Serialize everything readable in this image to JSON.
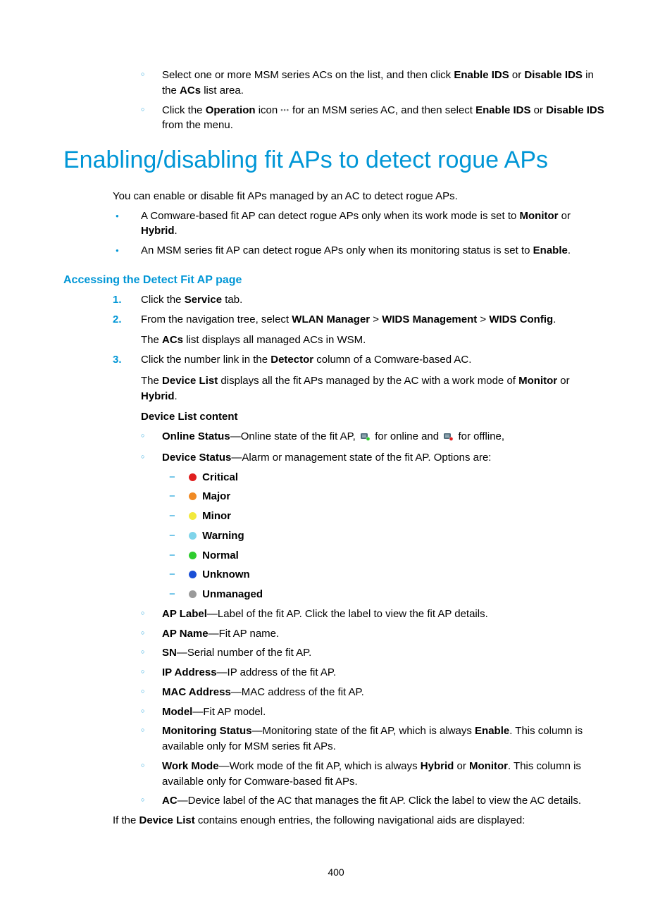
{
  "intro_bullets": [
    {
      "parts": [
        {
          "t": "Select one or more MSM series ACs on the list, and then click "
        },
        {
          "t": "Enable IDS",
          "b": true
        },
        {
          "t": " or "
        },
        {
          "t": "Disable IDS",
          "b": true
        },
        {
          "t": " in the "
        },
        {
          "t": "ACs",
          "b": true
        },
        {
          "t": " list area."
        }
      ]
    },
    {
      "parts": [
        {
          "t": "Click the "
        },
        {
          "t": "Operation",
          "b": true
        },
        {
          "t": " icon "
        },
        {
          "icon": "ellipsis"
        },
        {
          "t": " for an MSM series AC, and then select "
        },
        {
          "t": "Enable IDS",
          "b": true
        },
        {
          "t": " or "
        },
        {
          "t": "Disable IDS",
          "b": true
        },
        {
          "t": " from the menu."
        }
      ]
    }
  ],
  "title": "Enabling/disabling fit APs to detect rogue APs",
  "intro_para": "You can enable or disable fit APs managed by an AC to detect rogue APs.",
  "mode_bullets": [
    {
      "parts": [
        {
          "t": "A Comware-based fit AP can detect rogue APs only when its work mode is set to "
        },
        {
          "t": "Monitor",
          "b": true
        },
        {
          "t": " or "
        },
        {
          "t": "Hybrid",
          "b": true
        },
        {
          "t": "."
        }
      ]
    },
    {
      "parts": [
        {
          "t": "An MSM series fit AP can detect rogue APs only when its monitoring status is set to "
        },
        {
          "t": "Enable",
          "b": true
        },
        {
          "t": "."
        }
      ]
    }
  ],
  "subhead": "Accessing the Detect Fit AP page",
  "steps": [
    {
      "lines": [
        {
          "parts": [
            {
              "t": "Click the "
            },
            {
              "t": "Service",
              "b": true
            },
            {
              "t": " tab."
            }
          ]
        }
      ]
    },
    {
      "lines": [
        {
          "parts": [
            {
              "t": "From the navigation tree, select "
            },
            {
              "t": "WLAN Manager",
              "b": true
            },
            {
              "t": " > "
            },
            {
              "t": "WIDS Management",
              "b": true
            },
            {
              "t": " > "
            },
            {
              "t": "WIDS Config",
              "b": true
            },
            {
              "t": "."
            }
          ]
        },
        {
          "parts": [
            {
              "t": "The "
            },
            {
              "t": "ACs",
              "b": true
            },
            {
              "t": " list displays all managed ACs in WSM."
            }
          ]
        }
      ]
    },
    {
      "lines": [
        {
          "parts": [
            {
              "t": "Click the number link in the "
            },
            {
              "t": "Detector",
              "b": true
            },
            {
              "t": " column of a Comware-based AC."
            }
          ]
        },
        {
          "parts": [
            {
              "t": "The "
            },
            {
              "t": "Device List",
              "b": true
            },
            {
              "t": " displays all the fit APs managed by the AC with a work mode of "
            },
            {
              "t": "Monitor",
              "b": true
            },
            {
              "t": " or "
            },
            {
              "t": "Hybrid",
              "b": true
            },
            {
              "t": "."
            }
          ]
        },
        {
          "parts": [
            {
              "t": "Device List content",
              "b": true
            }
          ]
        }
      ]
    }
  ],
  "online_status": {
    "label": "Online Status",
    "text1": "—Online state of the fit AP, ",
    "text2": " for online and ",
    "text3": " for offline,"
  },
  "device_status": {
    "label": "Device Status",
    "tail": "—Alarm or management state of the fit AP. Options are:",
    "options": [
      {
        "name": "Critical",
        "color": "#e01f1f"
      },
      {
        "name": "Major",
        "color": "#f08a24"
      },
      {
        "name": "Minor",
        "color": "#f2e93c"
      },
      {
        "name": "Warning",
        "color": "#7fd4ea"
      },
      {
        "name": "Normal",
        "color": "#2ecc2e"
      },
      {
        "name": "Unknown",
        "color": "#1a4fd6"
      },
      {
        "name": "Unmanaged",
        "color": "#9a9a9a"
      }
    ]
  },
  "device_list_items": [
    {
      "label": "AP Label",
      "tail": "—Label of the fit AP. Click the label to view the fit AP details."
    },
    {
      "label": "AP Name",
      "tail": "—Fit AP name."
    },
    {
      "label": "SN",
      "tail": "—Serial number of the fit AP."
    },
    {
      "label": "IP Address",
      "tail": "—IP address of the fit AP."
    },
    {
      "label": "MAC Address",
      "tail": "—MAC address of the fit AP."
    },
    {
      "label": "Model",
      "tail": "—Fit AP model."
    }
  ],
  "monitoring_status": {
    "label": "Monitoring Status",
    "parts": [
      {
        "t": "—Monitoring state of the fit AP, which is always "
      },
      {
        "t": "Enable",
        "b": true
      },
      {
        "t": ". This column is available only for MSM series fit APs."
      }
    ]
  },
  "work_mode": {
    "label": "Work Mode",
    "parts": [
      {
        "t": "—Work mode of the fit AP, which is always "
      },
      {
        "t": "Hybrid",
        "b": true
      },
      {
        "t": " or "
      },
      {
        "t": "Monitor",
        "b": true
      },
      {
        "t": ". This column is available only for Comware-based fit APs."
      }
    ]
  },
  "ac_item": {
    "label": "AC",
    "tail": "—Device label of the AC that manages the fit AP. Click the label to view the AC details."
  },
  "closing": {
    "parts": [
      {
        "t": "If the "
      },
      {
        "t": "Device List",
        "b": true
      },
      {
        "t": " contains enough entries, the following navigational aids are displayed:"
      }
    ]
  },
  "page_number": "400"
}
